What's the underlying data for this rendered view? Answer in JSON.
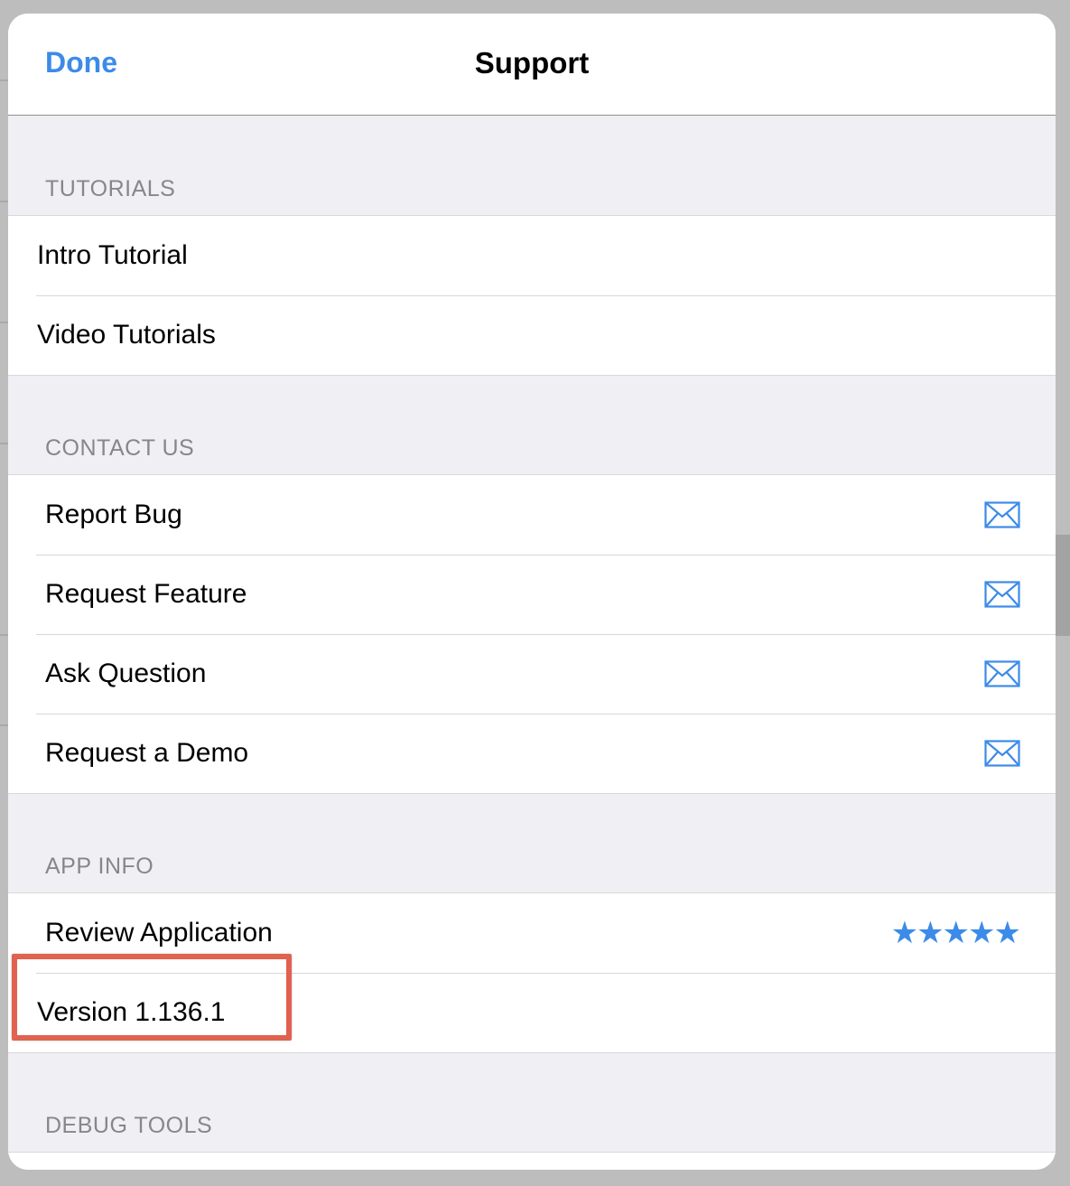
{
  "navbar": {
    "done_label": "Done",
    "title": "Support"
  },
  "sections": {
    "tutorials": {
      "header": "TUTORIALS",
      "items": [
        {
          "label": "Intro Tutorial"
        },
        {
          "label": "Video Tutorials"
        }
      ]
    },
    "contact": {
      "header": "CONTACT US",
      "items": [
        {
          "label": "Report Bug",
          "icon": "mail-icon"
        },
        {
          "label": "Request Feature",
          "icon": "mail-icon"
        },
        {
          "label": "Ask Question",
          "icon": "mail-icon"
        },
        {
          "label": "Request a Demo",
          "icon": "mail-icon"
        }
      ]
    },
    "app_info": {
      "header": "APP INFO",
      "review_label": "Review Application",
      "review_stars": "★★★★★",
      "version_label": "Version 1.136.1"
    },
    "debug": {
      "header": "DEBUG TOOLS"
    }
  },
  "colors": {
    "accent": "#3c8be8",
    "highlight": "#e0624f",
    "section_bg": "#efeff4"
  }
}
